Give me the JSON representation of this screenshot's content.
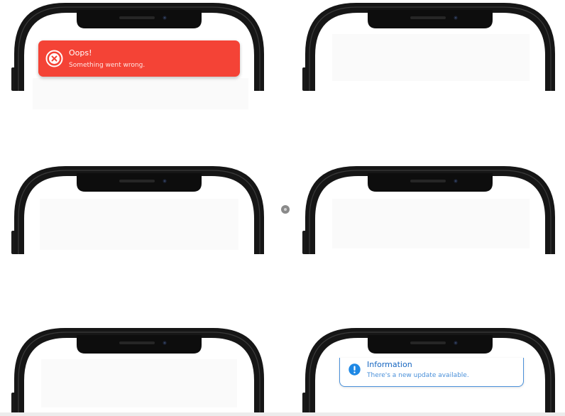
{
  "toasts": {
    "error": {
      "title": "Oops!",
      "message": "Something went wrong.",
      "icon": "error-circle-x-icon",
      "color": "#f44336"
    },
    "info": {
      "title": "Information",
      "message": "There's a new update available.",
      "icon": "info-circle-icon",
      "color": "#1e88e5"
    }
  },
  "colors": {
    "frame": "#161616",
    "notch": "#0d0d0d",
    "background": "#ffffff"
  }
}
